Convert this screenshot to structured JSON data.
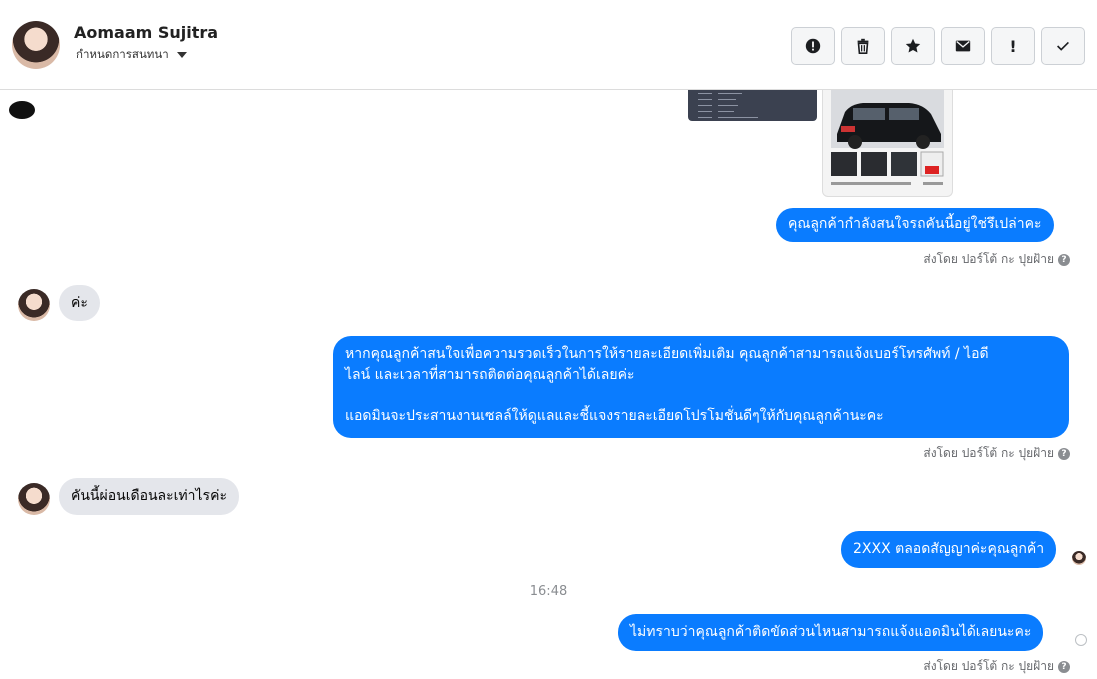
{
  "header": {
    "contact_name": "Aomaam Sujitra",
    "subtitle": "กำหนดการสนทนา"
  },
  "toolbar": {
    "icons": [
      "alert-circle-icon",
      "trash-icon",
      "star-icon",
      "envelope-icon",
      "exclamation-icon",
      "check-icon"
    ],
    "exclamation_text": "!"
  },
  "messages": [
    {
      "from": "page",
      "text": "คุณลูกค้ากำลังสนใจรถคันนี้อยู่ใช่รึเปล่าคะ",
      "sent_by": "ส่งโดย ปอร์โต้ กะ ปุยฝ้าย"
    },
    {
      "from": "customer",
      "text": "ค่ะ"
    },
    {
      "from": "page",
      "text_line1": "หากคุณลูกค้าสนใจเพื่อความรวดเร็วในการให้รายละเอียดเพิ่มเติม คุณลูกค้าสามารถแจ้งเบอร์โทรศัพท์ / ไอดี",
      "text_line2": "ไลน์ และเวลาที่สามารถติดต่อคุณลูกค้าได้เลยค่ะ",
      "text_line3": "แอดมินจะประสานงานเซลล์ให้ดูแลและชี้แจงรายละเอียดโปรโมชั่นดีๆให้กับคุณลูกค้านะคะ",
      "sent_by": "ส่งโดย ปอร์โต้ กะ ปุยฝ้าย"
    },
    {
      "from": "customer",
      "text": "คันนี้ผ่อนเดือนละเท่าไรค่ะ"
    },
    {
      "from": "page",
      "text": "2XXX ตลอดสัญญาค่ะคุณลูกค้า"
    },
    {
      "from": "page",
      "text": "ไม่ทราบว่าคุณลูกค้าติดขัดส่วนไหนสามารถแจ้งแอดมินได้เลยนะคะ",
      "sent_by": "ส่งโดย ปอร์โต้ กะ ปุยฝ้าย"
    }
  ],
  "timestamp": "16:48",
  "help_glyph": "?",
  "colors": {
    "outgoing_bubble": "#0a7cff",
    "incoming_bubble": "#e4e6eb"
  }
}
